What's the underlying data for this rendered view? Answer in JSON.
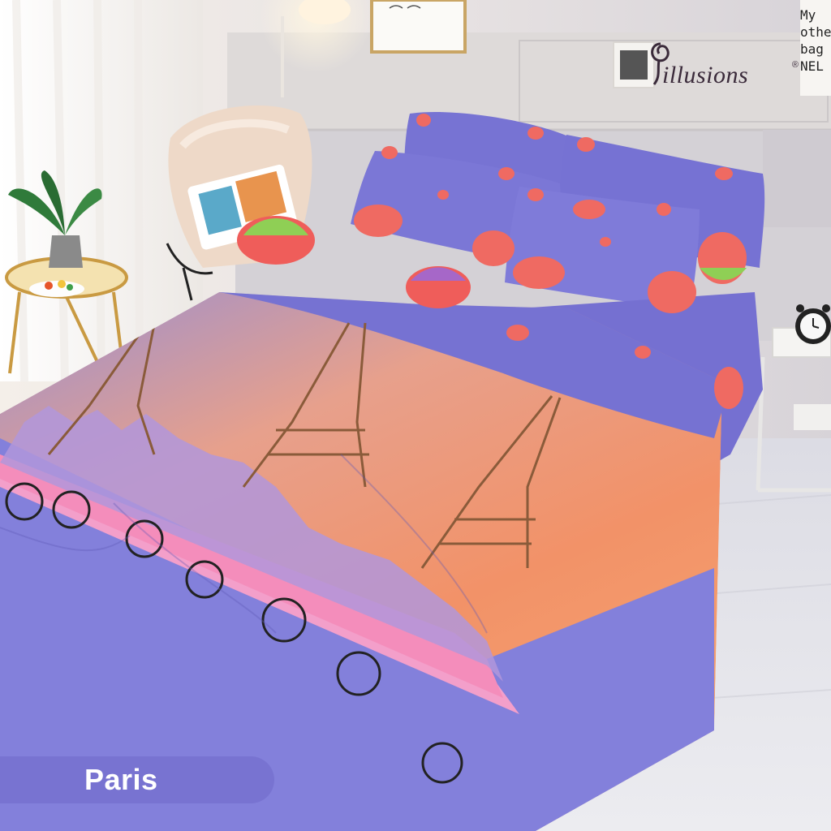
{
  "brand": {
    "name": "illusions",
    "registered_mark": "®"
  },
  "wall_note_lines": [
    "My",
    "other",
    "bag",
    "NEL"
  ],
  "product_label": "Paris",
  "colors": {
    "label_bg": "#7873d1",
    "label_text": "#ffffff",
    "bedding_lavender": "#7c78d8",
    "sunset_orange": "#f0946a",
    "stripe_pink": "#f29ac6"
  },
  "scene_objects": [
    "bedroom-wall",
    "window-curtain",
    "fur-chair",
    "side-table",
    "potted-plant",
    "bed",
    "pillows",
    "duvet",
    "nightstand",
    "alarm-clock",
    "wall-frame"
  ]
}
